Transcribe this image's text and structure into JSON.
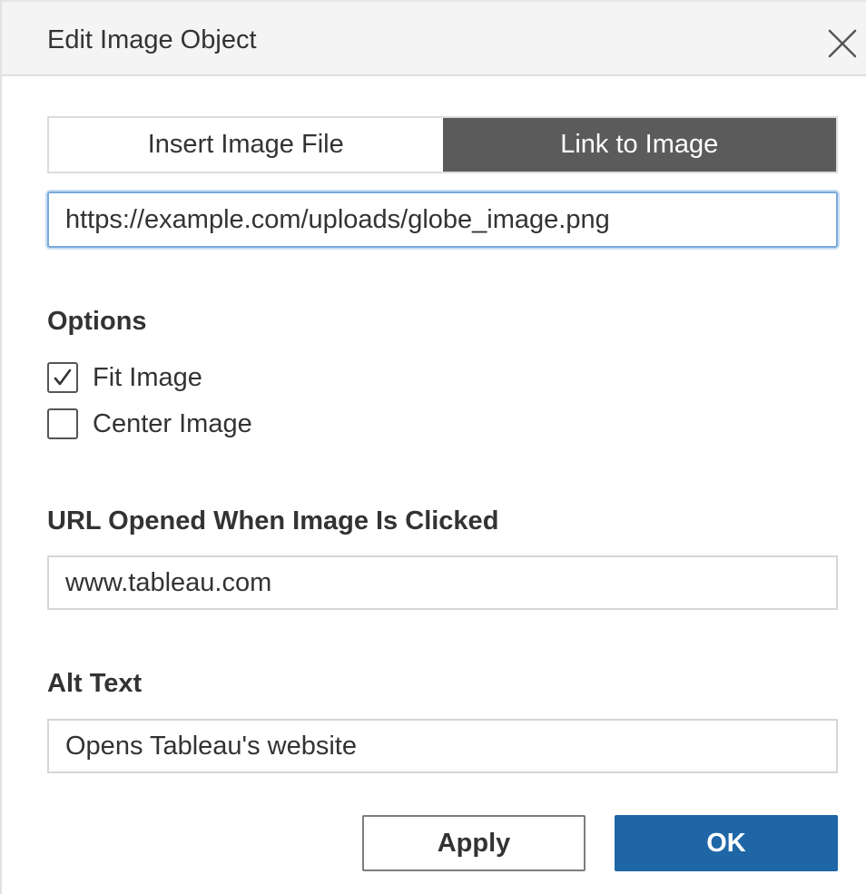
{
  "dialog": {
    "title": "Edit Image Object",
    "close_icon": "close-icon"
  },
  "tabs": [
    {
      "label": "Insert Image File",
      "active": false
    },
    {
      "label": "Link to Image",
      "active": true
    }
  ],
  "image_url": {
    "value": "https://example.com/uploads/globe_image.png"
  },
  "options": {
    "heading": "Options",
    "fit_image": {
      "label": "Fit Image",
      "checked": true
    },
    "center_image": {
      "label": "Center Image",
      "checked": false
    }
  },
  "click_url": {
    "label": "URL Opened When Image Is Clicked",
    "value": "www.tableau.com"
  },
  "alt_text": {
    "label": "Alt Text",
    "value": "Opens Tableau's website"
  },
  "buttons": {
    "apply": "Apply",
    "ok": "OK"
  },
  "colors": {
    "active_tab": "#5b5b5b",
    "ok_button": "#1f66a6",
    "focus_border": "#7aa9dc"
  }
}
